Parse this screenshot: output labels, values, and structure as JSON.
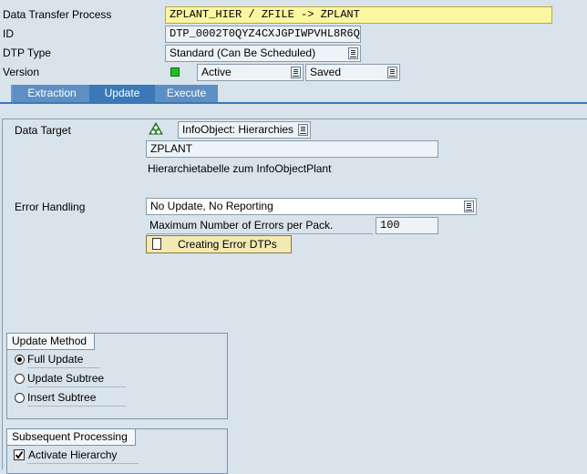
{
  "header": {
    "dtp_label": "Data Transfer Process",
    "dtp_value": "ZPLANT_HIER / ZFILE -> ZPLANT",
    "id_label": "ID",
    "id_value": "DTP_0002T0QYZ4CXJGPIWPVHL8R6Q",
    "type_label": "DTP Type",
    "type_value": "Standard (Can Be Scheduled)",
    "version_label": "Version",
    "version_value": "Active",
    "status_value": "Saved",
    "status_indicator_color": "#1fc01f"
  },
  "tabs": [
    {
      "label": "Extraction"
    },
    {
      "label": "Update"
    },
    {
      "label": "Execute"
    }
  ],
  "active_tab": "Update",
  "update": {
    "target_label": "Data Target",
    "target_type": "InfoObject: Hierarchies",
    "target_name": "ZPLANT",
    "target_desc": "Hierarchietabelle zum InfoObjectPlant",
    "error_label": "Error Handling",
    "error_value": "No Update, No Reporting",
    "max_errors_label": "Maximum Number of Errors per Pack.",
    "max_errors_value": "100",
    "error_dtp_button": "Creating Error DTPs"
  },
  "update_method": {
    "title": "Update Method",
    "options": [
      {
        "label": "Full Update",
        "selected": true
      },
      {
        "label": "Update Subtree",
        "selected": false
      },
      {
        "label": "Insert Subtree",
        "selected": false
      }
    ]
  },
  "subsequent": {
    "title": "Subsequent Processing",
    "activate_label": "Activate Hierarchy",
    "activate_checked": true
  },
  "colors": {
    "background": "#d9e3ec",
    "tab_active": "#3a78b8",
    "tab_inactive": "#5d8fc4",
    "target_icon": "#3aa03a"
  }
}
